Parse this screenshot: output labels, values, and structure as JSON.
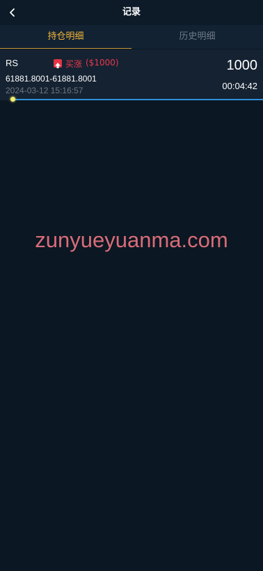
{
  "header": {
    "title": "记录"
  },
  "tabs": [
    {
      "label": "持仓明细",
      "active": true
    },
    {
      "label": "历史明细",
      "active": false
    }
  ],
  "position": {
    "symbol": "RS",
    "direction": "买涨",
    "amount_tag": "($1000)",
    "price_range": "61881.8001-61881.8001",
    "open_time": "2024-03-12 15:16:57",
    "amount": "1000",
    "countdown": "00:04:42",
    "progress": 0.0
  },
  "watermark": "zunyueyuanma.com",
  "colors": {
    "background": "#0b1722",
    "card": "#152232",
    "accent": "#f3b53a",
    "up": "#e8394b",
    "progress": "#2f8fd9"
  },
  "icons": {
    "back": "chevron-left-icon",
    "direction": "arrow-up-icon"
  }
}
